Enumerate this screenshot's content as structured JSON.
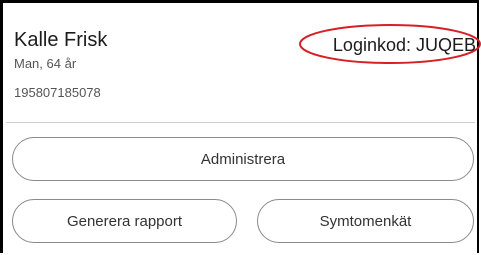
{
  "patient": {
    "name": "Kalle Frisk",
    "sex_age": "Man, 64 år",
    "personal_number": "195807185078"
  },
  "login": {
    "code_text": "Loginkod: JUQEB",
    "highlight_color": "#d81f26"
  },
  "actions": {
    "administer_label": "Administrera",
    "generate_report_label": "Generera rapport",
    "symptom_survey_label": "Symtomenkät"
  },
  "colors": {
    "frame": "#000000",
    "button_border": "#8a8a8a",
    "text": "#1c1c1c",
    "muted_text": "#555555"
  }
}
